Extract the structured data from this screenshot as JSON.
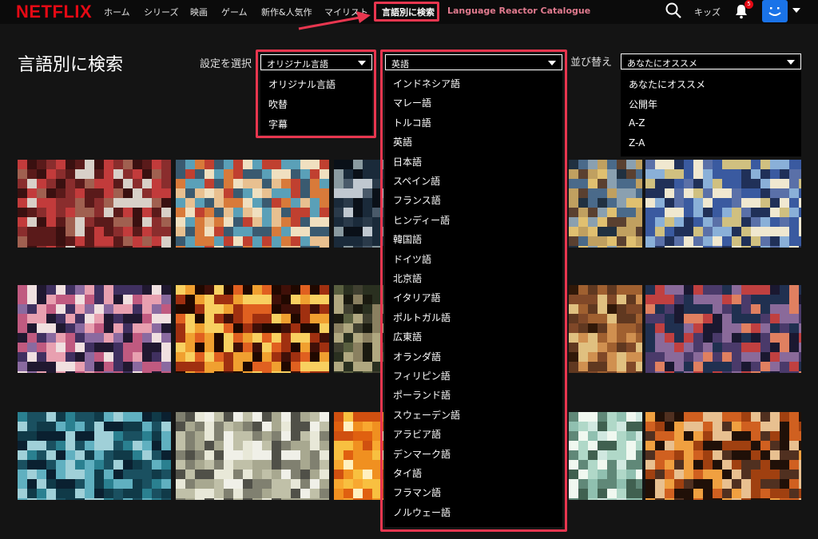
{
  "nav": {
    "logo": "NETFLIX",
    "links": [
      "ホーム",
      "シリーズ",
      "映画",
      "ゲーム",
      "新作&人気作",
      "マイリスト",
      "言語別に検索",
      "Language Reactor Catalogue"
    ],
    "kids": "キッズ",
    "notification_count": "5"
  },
  "page": {
    "title": "言語別に検索",
    "setting_label": "設定を選択",
    "sort_label": "並び替え"
  },
  "filter_select": {
    "value": "オリジナル言語",
    "options": [
      "オリジナル言語",
      "吹替",
      "字幕"
    ]
  },
  "language_select": {
    "value": "英語",
    "options": [
      "インドネシア語",
      "マレー語",
      "トルコ語",
      "英語",
      "日本語",
      "スペイン語",
      "フランス語",
      "ヒンディー語",
      "韓国語",
      "ドイツ語",
      "北京語",
      "イタリア語",
      "ポルトガル語",
      "広東語",
      "オランダ語",
      "フィリピン語",
      "ポーランド語",
      "スウェーデン語",
      "アラビア語",
      "デンマーク語",
      "タイ語",
      "フラマン語",
      "ノルウェー語"
    ]
  },
  "sort_select": {
    "value": "あなたにオススメ",
    "options": [
      "あなたにオススメ",
      "公開年",
      "A-Z",
      "Z-A"
    ]
  },
  "colors": {
    "brand": "#e50914",
    "highlight": "#e8364f",
    "background": "#141414"
  }
}
